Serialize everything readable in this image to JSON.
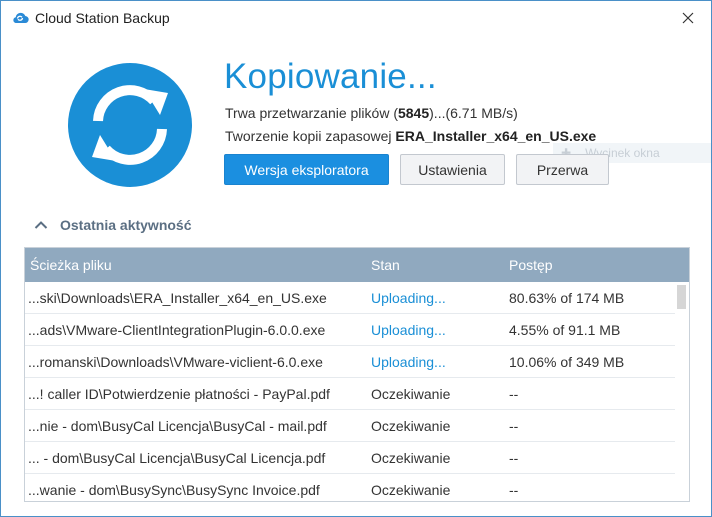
{
  "window": {
    "title": "Cloud Station Backup",
    "accent": "#1a8fd6"
  },
  "status": {
    "heading": "Kopiowanie...",
    "processing_prefix": "Trwa przetwarzanie plików (",
    "processing_count": "5845",
    "processing_suffix": ")...(6.71 MB/s)",
    "backup_prefix": "Tworzenie kopii zapasowej ",
    "backup_file": "ERA_Installer_x64_en_US.exe"
  },
  "buttons": {
    "explorer": "Wersja eksploratora",
    "settings": "Ustawienia",
    "pause": "Przerwa"
  },
  "ghost_tooltip": "Wycinek okna",
  "activity": {
    "section_label": "Ostatnia aktywność",
    "columns": {
      "path": "Ścieżka pliku",
      "state": "Stan",
      "progress": "Postęp"
    },
    "rows": [
      {
        "path": "...ski\\Downloads\\ERA_Installer_x64_en_US.exe",
        "state": "Uploading...",
        "progress": "80.63% of 174 MB",
        "active": true
      },
      {
        "path": "...ads\\VMware-ClientIntegrationPlugin-6.0.0.exe",
        "state": "Uploading...",
        "progress": "4.55% of 91.1 MB",
        "active": true
      },
      {
        "path": "...romanski\\Downloads\\VMware-viclient-6.0.exe",
        "state": "Uploading...",
        "progress": "10.06% of 349 MB",
        "active": true
      },
      {
        "path": "...! caller ID\\Potwierdzenie płatności - PayPal.pdf",
        "state": "Oczekiwanie",
        "progress": "--",
        "active": false
      },
      {
        "path": "...nie - dom\\BusyCal Licencja\\BusyCal - mail.pdf",
        "state": "Oczekiwanie",
        "progress": "--",
        "active": false
      },
      {
        "path": "... - dom\\BusyCal Licencja\\BusyCal Licencja.pdf",
        "state": "Oczekiwanie",
        "progress": "--",
        "active": false
      },
      {
        "path": "...wanie - dom\\BusySync\\BusySync Invoice.pdf",
        "state": "Oczekiwanie",
        "progress": "--",
        "active": false
      }
    ]
  },
  "icons": {
    "title": "cloud-icon",
    "close": "close-icon",
    "logo": "sync-icon",
    "collapse": "chevron-up-icon"
  }
}
